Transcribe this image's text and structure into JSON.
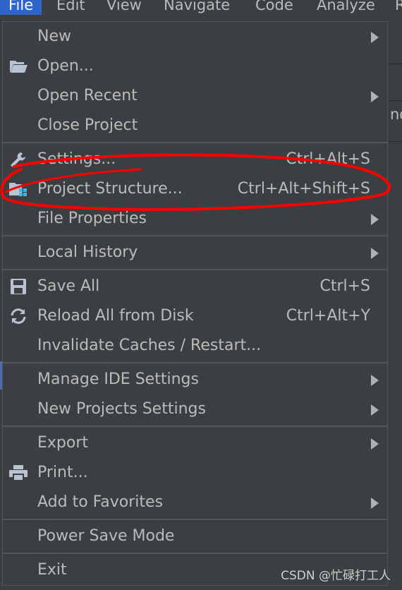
{
  "menubar": {
    "items": [
      "File",
      "Edit",
      "View",
      "Navigate",
      "Code",
      "Analyze",
      "R"
    ]
  },
  "background": {
    "partial_text": "nd"
  },
  "menu": {
    "groups": [
      [
        {
          "label": "New",
          "shortcut": "",
          "submenu": true,
          "icon": ""
        },
        {
          "label": "Open...",
          "shortcut": "",
          "submenu": false,
          "icon": "folder-open-icon"
        },
        {
          "label": "Open Recent",
          "shortcut": "",
          "submenu": true,
          "icon": ""
        },
        {
          "label": "Close Project",
          "shortcut": "",
          "submenu": false,
          "icon": ""
        }
      ],
      [
        {
          "label": "Settings...",
          "shortcut": "Ctrl+Alt+S",
          "submenu": false,
          "icon": "wrench-icon"
        },
        {
          "label": "Project Structure...",
          "shortcut": "Ctrl+Alt+Shift+S",
          "submenu": false,
          "icon": "project-structure-icon"
        },
        {
          "label": "File Properties",
          "shortcut": "",
          "submenu": true,
          "icon": ""
        }
      ],
      [
        {
          "label": "Local History",
          "shortcut": "",
          "submenu": true,
          "icon": ""
        }
      ],
      [
        {
          "label": "Save All",
          "shortcut": "Ctrl+S",
          "submenu": false,
          "icon": "save-icon"
        },
        {
          "label": "Reload All from Disk",
          "shortcut": "Ctrl+Alt+Y",
          "submenu": false,
          "icon": "reload-icon"
        },
        {
          "label": "Invalidate Caches / Restart...",
          "shortcut": "",
          "submenu": false,
          "icon": ""
        }
      ],
      [
        {
          "label": "Manage IDE Settings",
          "shortcut": "",
          "submenu": true,
          "icon": ""
        },
        {
          "label": "New Projects Settings",
          "shortcut": "",
          "submenu": true,
          "icon": ""
        }
      ],
      [
        {
          "label": "Export",
          "shortcut": "",
          "submenu": true,
          "icon": ""
        },
        {
          "label": "Print...",
          "shortcut": "",
          "submenu": false,
          "icon": "printer-icon"
        },
        {
          "label": "Add to Favorites",
          "shortcut": "",
          "submenu": true,
          "icon": ""
        }
      ],
      [
        {
          "label": "Power Save Mode",
          "shortcut": "",
          "submenu": false,
          "icon": ""
        }
      ],
      [
        {
          "label": "Exit",
          "shortcut": "",
          "submenu": false,
          "icon": ""
        }
      ]
    ]
  },
  "watermark": "CSDN @忙碌打工人",
  "colors": {
    "menu_bg": "#3c3f41",
    "active_menu": "#2f65ca",
    "text": "#bbbbbb",
    "annotation": "#ff0000"
  }
}
